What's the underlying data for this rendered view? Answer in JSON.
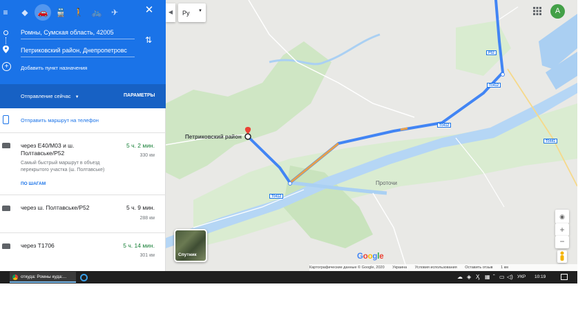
{
  "modes": {
    "menu": "≡",
    "best": "◆",
    "car": "🚗",
    "transit": "🚆",
    "walk": "🚶",
    "bike": "🚲",
    "plane": "✈",
    "close": "✕"
  },
  "waypoints": {
    "origin": "Ромны, Сумская область, 42005",
    "destination": "Петриковский район, Днепропетровс",
    "add_label": "Добавить пункт назначения"
  },
  "depart": {
    "label": "Отправление сейчас",
    "params_label": "ПАРАМЕТРЫ"
  },
  "send_label": "Отправить маршрут на телефон",
  "routes": [
    {
      "via": "через Е40/М03 и ш. Полтавське/Р52",
      "time": "5 ч. 2 мин.",
      "distance": "330 км",
      "note": "Самый быстрый маршрут в объезд перекрытого участка (ш. Полтавське)",
      "steps_label": "ПО ШАГАМ"
    },
    {
      "via": "через ш. Полтавське/Р52",
      "time": "5 ч. 9 мин.",
      "distance": "288 км"
    },
    {
      "via": "через Т1706",
      "time": "5 ч. 14 мин.",
      "distance": "301 км"
    }
  ],
  "map": {
    "lang": "Ру",
    "collapse": "◀",
    "place_label": "Петриковский район",
    "town_label": "Проточи",
    "avatar_letter": "A",
    "satellite_label": "Спутник",
    "zoom_in": "+",
    "zoom_out": "−",
    "locate": "◉",
    "road_badges": {
      "p52": "P52",
      "t0412a": "T0412",
      "t0412b": "T0412",
      "t0412c": "T0412",
      "t0441": "T0441"
    },
    "attribution": [
      "Картографические данные © Google, 2020",
      "Украина",
      "Условия использования",
      "Оставить отзыв",
      "1 км"
    ],
    "accent": "#1a73e8",
    "route_color": "#4285f4",
    "traffic_color": "#e8a04b"
  },
  "taskbar": {
    "chrome_label": "откуда: Ромны куда:...",
    "lang": "УКР",
    "time": "10:19"
  }
}
